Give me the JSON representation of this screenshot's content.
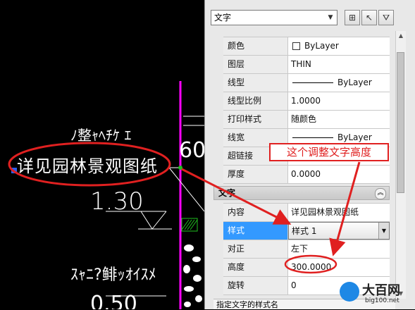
{
  "canvas": {
    "text_upper": "ﾉ整ｬﾍﾁｹ ｴ",
    "text_main": "详见园林景观图纸",
    "dim_1": "1.30",
    "text_lower": "ｽｬﾆ?鲱ｯｵｲｽﾒ",
    "dim_2": "0.50",
    "text_side": "60"
  },
  "panel": {
    "object_type": "文字",
    "buttons": [
      "quick-select-icon",
      "select-objects-icon",
      "pickadd-icon"
    ],
    "general_rows": [
      {
        "key": "颜色",
        "value": "ByLayer"
      },
      {
        "key": "图层",
        "value": "THIN"
      },
      {
        "key": "线型",
        "value": "ByLayer"
      },
      {
        "key": "线型比例",
        "value": "1.0000"
      },
      {
        "key": "打印样式",
        "value": "随颜色"
      },
      {
        "key": "线宽",
        "value": "ByLayer"
      },
      {
        "key": "超链接",
        "value": ""
      },
      {
        "key": "厚度",
        "value": "0.0000"
      }
    ],
    "text_section_title": "文字",
    "text_rows": [
      {
        "key": "内容",
        "value": "详见园林景观图纸"
      },
      {
        "key": "样式",
        "value": "样式 1"
      },
      {
        "key": "对正",
        "value": "左下"
      },
      {
        "key": "高度",
        "value": "300.0000"
      },
      {
        "key": "旋转",
        "value": "0"
      }
    ],
    "status_text": "指定文字的样式名"
  },
  "annotation": {
    "callout": "这个调整文字高度",
    "color": "#e02020"
  },
  "watermark": {
    "title": "大百网",
    "url": "big100.net"
  },
  "colors": {
    "magenta_line": "#ff00ff",
    "selection": "#3399ff",
    "dim_line": "#ffffff"
  }
}
